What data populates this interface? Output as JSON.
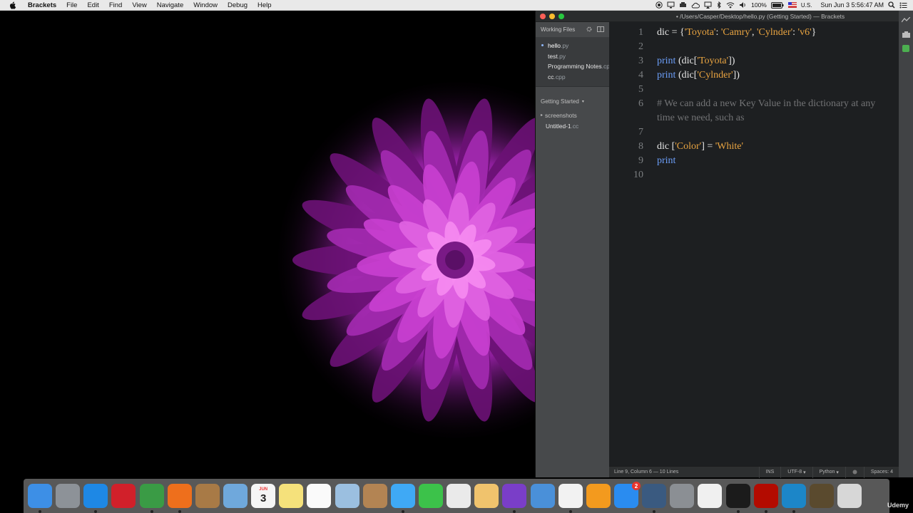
{
  "menubar": {
    "app_name": "Brackets",
    "items": [
      "File",
      "Edit",
      "Find",
      "View",
      "Navigate",
      "Window",
      "Debug",
      "Help"
    ],
    "battery": "100%",
    "input_source": "U.S.",
    "clock": "Sun Jun 3  5:56:47 AM"
  },
  "window": {
    "title": "• /Users/Casper/Desktop/hello.py (Getting Started) — Brackets"
  },
  "sidebar": {
    "working_files_label": "Working Files",
    "working_files": [
      {
        "name": "hello",
        "ext": ".py",
        "active": true
      },
      {
        "name": "test",
        "ext": ".py",
        "active": false
      },
      {
        "name": "Programming Notes",
        "ext": ".cp",
        "active": false
      },
      {
        "name": "cc",
        "ext": ".cpp",
        "active": false
      }
    ],
    "project_label": "Getting Started",
    "tree": [
      {
        "name": "screenshots",
        "type": "folder"
      },
      {
        "name": "Untitled-1",
        "ext": ".cc",
        "type": "file"
      }
    ]
  },
  "editor": {
    "lines": [
      {
        "n": "1",
        "tokens": [
          {
            "t": "dic = {",
            "c": ""
          },
          {
            "t": "'Toyota'",
            "c": "str"
          },
          {
            "t": ": ",
            "c": ""
          },
          {
            "t": "'Camry'",
            "c": "str"
          },
          {
            "t": ", ",
            "c": ""
          },
          {
            "t": "'Cylnder'",
            "c": "str"
          },
          {
            "t": ": ",
            "c": ""
          },
          {
            "t": "'v6'",
            "c": "str"
          },
          {
            "t": "}",
            "c": ""
          }
        ]
      },
      {
        "n": "2",
        "tokens": []
      },
      {
        "n": "3",
        "tokens": [
          {
            "t": "print",
            "c": "kw"
          },
          {
            "t": " (dic[",
            "c": ""
          },
          {
            "t": "'Toyota'",
            "c": "str"
          },
          {
            "t": "])",
            "c": ""
          }
        ]
      },
      {
        "n": "4",
        "tokens": [
          {
            "t": "print",
            "c": "kw"
          },
          {
            "t": " (dic[",
            "c": ""
          },
          {
            "t": "'Cylnder'",
            "c": "str"
          },
          {
            "t": "])",
            "c": ""
          }
        ]
      },
      {
        "n": "5",
        "tokens": []
      },
      {
        "n": "6",
        "tokens": [
          {
            "t": "# We can add a new Key Value in the dictionary at any time we need, such as",
            "c": "cm"
          }
        ]
      },
      {
        "n": "",
        "tokens": []
      },
      {
        "n": "7",
        "tokens": []
      },
      {
        "n": "8",
        "tokens": [
          {
            "t": "dic [",
            "c": ""
          },
          {
            "t": "'Color'",
            "c": "str"
          },
          {
            "t": "] = ",
            "c": ""
          },
          {
            "t": "'White'",
            "c": "str"
          }
        ]
      },
      {
        "n": "9",
        "tokens": [
          {
            "t": "print",
            "c": "kw"
          }
        ]
      },
      {
        "n": "10",
        "tokens": []
      }
    ],
    "colors": {
      "keyword": "#6c9ef8",
      "string": "#e9a441",
      "comment": "#727375",
      "background": "#1d1f21"
    }
  },
  "statusbar": {
    "position": "Line 9, Column 6 — 10 Lines",
    "mode": "INS",
    "encoding": "UTF-8",
    "language": "Python",
    "spaces": "Spaces: 4"
  },
  "dock": {
    "apps": [
      {
        "name": "finder-icon",
        "color": "#3d8fe6"
      },
      {
        "name": "launchpad-icon",
        "color": "#8d9298"
      },
      {
        "name": "safari-icon",
        "color": "#1e88e5"
      },
      {
        "name": "opera-icon",
        "color": "#d1202a"
      },
      {
        "name": "chrome-icon",
        "color": "#3a9b45"
      },
      {
        "name": "firefox-icon",
        "color": "#ee6f1c"
      },
      {
        "name": "notes-stack-icon",
        "color": "#a87a46"
      },
      {
        "name": "preview-icon",
        "color": "#6fa8dc"
      },
      {
        "name": "calendar-icon",
        "color": "#f5f5f5",
        "text": "3"
      },
      {
        "name": "stickies-icon",
        "color": "#f5e17b"
      },
      {
        "name": "reminders-icon",
        "color": "#fafafa"
      },
      {
        "name": "photo-preview-icon",
        "color": "#9bbfe0"
      },
      {
        "name": "contacts-icon",
        "color": "#b38453"
      },
      {
        "name": "messages-icon",
        "color": "#3fa9f5"
      },
      {
        "name": "facetime-icon",
        "color": "#3cc24a"
      },
      {
        "name": "numbers-icon",
        "color": "#eaeaea"
      },
      {
        "name": "keynote-desk-icon",
        "color": "#f0c36d"
      },
      {
        "name": "imovie-icon",
        "color": "#7a3ec8"
      },
      {
        "name": "keynote-icon",
        "color": "#4a90d9"
      },
      {
        "name": "itunes-icon",
        "color": "#f2f2f2"
      },
      {
        "name": "ibooks-icon",
        "color": "#f39a1e"
      },
      {
        "name": "app-store-icon",
        "color": "#2a8cf0",
        "badge": "2"
      },
      {
        "name": "quicktime-icon",
        "color": "#3a5a80"
      },
      {
        "name": "system-preferences-icon",
        "color": "#8b8f94"
      },
      {
        "name": "textedit-icon",
        "color": "#f0f0f0"
      },
      {
        "name": "terminal-icon",
        "color": "#1b1b1b"
      },
      {
        "name": "acrobat-icon",
        "color": "#b30b00"
      },
      {
        "name": "brackets-icon",
        "color": "#1c86c8"
      },
      {
        "name": "document-icon",
        "color": "#5a4a2e"
      },
      {
        "name": "trash-icon",
        "color": "#d7d7d7"
      }
    ],
    "calendar_month": "JUN"
  },
  "watermark": "Udemy"
}
